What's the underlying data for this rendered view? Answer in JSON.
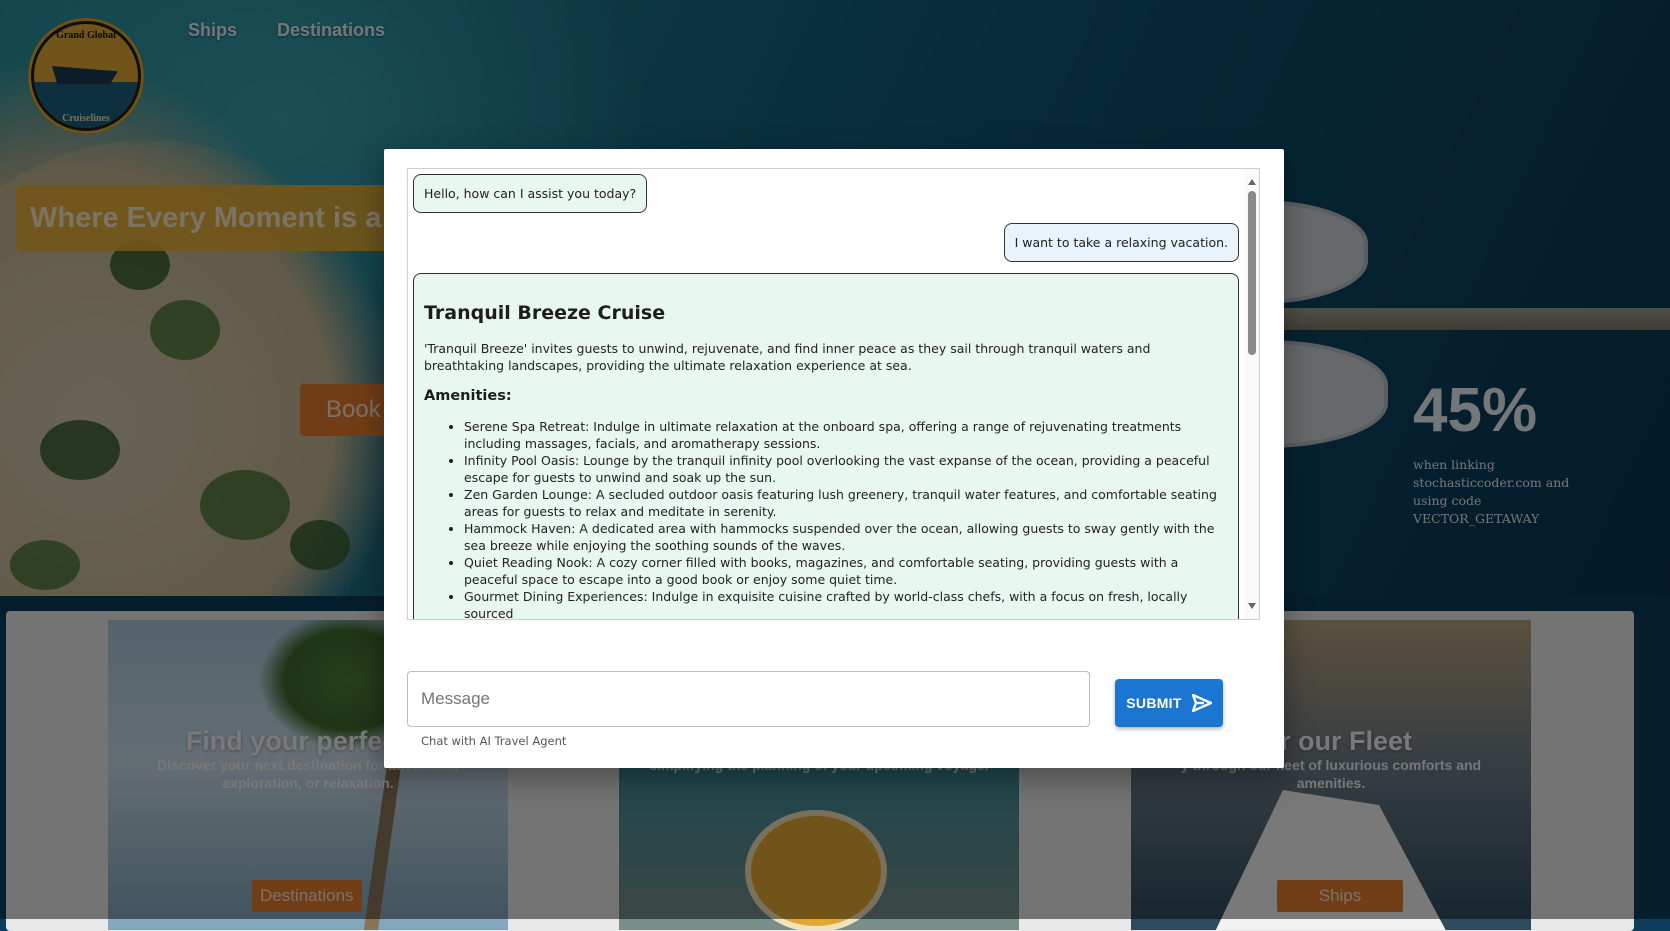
{
  "header": {
    "logo": {
      "text_top": "Grand Global",
      "text_bottom": "Cruiselines"
    },
    "nav": [
      "Ships",
      "Destinations"
    ]
  },
  "hero": {
    "tagline": "Where Every Moment is a",
    "book_label": "Book",
    "promo": {
      "percent": "45%",
      "text": "when linking stochasticcoder.com and using code VECTOR_GETAWAY"
    }
  },
  "cards": [
    {
      "title": "Find your perfect g",
      "desc": "Discover your next destination for adventure, exploration, or relaxation.",
      "button": "Destinations"
    },
    {
      "title": "",
      "desc": "simplifying the planning of your upcoming voyage.",
      "button": ""
    },
    {
      "title": "ver our Fleet",
      "desc": "y through our fleet of luxurious comforts and amenities.",
      "button": "Ships"
    }
  ],
  "chat": {
    "messages": {
      "bot_greeting": "Hello, how can I assist you today?",
      "user": "I want to take a relaxing vacation."
    },
    "response": {
      "title": "Tranquil Breeze Cruise",
      "description": "'Tranquil Breeze' invites guests to unwind, rejuvenate, and find inner peace as they sail through tranquil waters and breathtaking landscapes, providing the ultimate relaxation experience at sea.",
      "amenities_heading": "Amenities:",
      "amenities": [
        "Serene Spa Retreat: Indulge in ultimate relaxation at the onboard spa, offering a range of rejuvenating treatments including massages, facials, and aromatherapy sessions.",
        "Infinity Pool Oasis: Lounge by the tranquil infinity pool overlooking the vast expanse of the ocean, providing a peaceful escape for guests to unwind and soak up the sun.",
        "Zen Garden Lounge: A secluded outdoor oasis featuring lush greenery, tranquil water features, and comfortable seating areas for guests to relax and meditate in serenity.",
        "Hammock Haven: A dedicated area with hammocks suspended over the ocean, allowing guests to sway gently with the sea breeze while enjoying the soothing sounds of the waves.",
        "Quiet Reading Nook: A cozy corner filled with books, magazines, and comfortable seating, providing guests with a peaceful space to escape into a good book or enjoy some quiet time.",
        "Gourmet Dining Experiences: Indulge in exquisite cuisine crafted by world-class chefs, with a focus on fresh, locally sourced"
      ]
    },
    "input": {
      "placeholder": "Message",
      "value": "",
      "helper": "Chat with AI Travel Agent"
    },
    "submit_label": "SUBMIT"
  },
  "colors": {
    "accent": "#1b76d2",
    "bot_bubble": "#e8f8ee",
    "user_bubble": "#e9f3fb",
    "orange": "#e07a2c",
    "gold": "#e0a833"
  }
}
